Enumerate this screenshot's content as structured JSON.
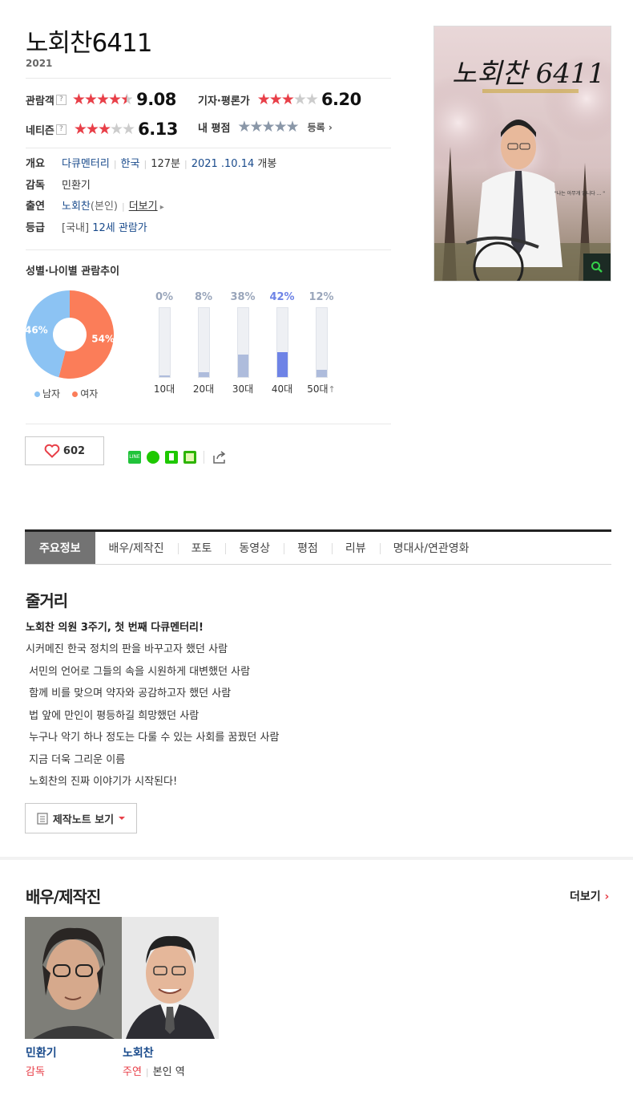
{
  "movie": {
    "title": "노회찬6411",
    "year": "2021"
  },
  "ratings": {
    "audience": {
      "label": "관람객",
      "help": "?",
      "stars": 4.5,
      "score": "9.08"
    },
    "critic": {
      "label": "기자·평론가",
      "stars": 3,
      "score": "6.20"
    },
    "netizen": {
      "label": "네티즌",
      "help": "?",
      "stars": 3,
      "score": "6.13"
    },
    "mine": {
      "label": "내 평점",
      "action": "등록"
    }
  },
  "info": {
    "overview_label": "개요",
    "genre": "다큐멘터리",
    "country": "한국",
    "runtime": "127분",
    "release_date": "2021 .10.14",
    "release_suffix": "개봉",
    "director_label": "감독",
    "director": "민환기",
    "cast_label": "출연",
    "cast_name": "노회찬",
    "cast_note": "(본인)",
    "cast_more": "더보기",
    "rating_label": "등급",
    "rating_region": "[국내]",
    "rating_value": "12세 관람가"
  },
  "poster": {
    "headline": "노회찬 6411",
    "quote": "\"나는 아무개 입니다 ... \""
  },
  "stats": {
    "title": "성별·나이별 관람추이",
    "gender": [
      {
        "label": "남자",
        "pct": 46,
        "text": "46%",
        "color": "#8cc3f3"
      },
      {
        "label": "여자",
        "pct": 54,
        "text": "54%",
        "color": "#fb7d59"
      }
    ],
    "ages": [
      {
        "label": "10대",
        "pct": 0,
        "text": "0%"
      },
      {
        "label": "20대",
        "pct": 8,
        "text": "8%"
      },
      {
        "label": "30대",
        "pct": 38,
        "text": "38%"
      },
      {
        "label": "40대",
        "pct": 42,
        "text": "42%",
        "highlight": true
      },
      {
        "label": "50대",
        "pct": 12,
        "text": "12%"
      }
    ],
    "highlight_color": "#6e83e6",
    "bar_color": "#aebcdc"
  },
  "like": {
    "count": "602"
  },
  "tabs": [
    "주요정보",
    "배우/제작진",
    "포토",
    "동영상",
    "평점",
    "리뷰",
    "명대사/연관영화"
  ],
  "synopsis": {
    "heading": "줄거리",
    "lead": "노회찬 의원 3주기, 첫 번째 다큐멘터리!",
    "lines": [
      "시커메진 한국 정치의 판을 바꾸고자 했던 사람",
      " 서민의 언어로 그들의 속을 시원하게 대변했던 사람",
      " 함께 비를 맞으며 약자와 공감하고자 했던 사람",
      " 법 앞에 만인이 평등하길 희망했던 사람",
      " 누구나 악기 하나 정도는 다룰 수 있는 사회를 꿈꿨던 사람",
      " 지금 더욱 그리운 이름",
      " 노회찬의 진짜 이야기가 시작된다!"
    ],
    "note_button": "제작노트 보기"
  },
  "cast": {
    "heading": "배우/제작진",
    "more": "더보기",
    "people": [
      {
        "name": "민환기",
        "role": "감독",
        "character": ""
      },
      {
        "name": "노회찬",
        "role": "주연",
        "character": "본인 역"
      }
    ]
  }
}
